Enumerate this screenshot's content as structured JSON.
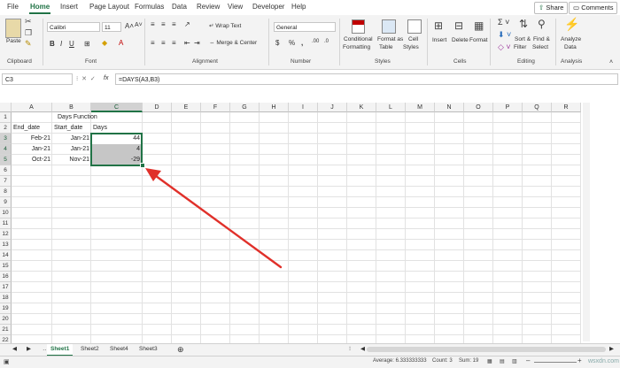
{
  "menu": {
    "items": [
      "File",
      "Home",
      "Insert",
      "Page Layout",
      "Formulas",
      "Data",
      "Review",
      "View",
      "Developer",
      "Help"
    ],
    "share_label": "Share",
    "comments_label": "Comments"
  },
  "ribbon": {
    "clipboard": {
      "paste": "Paste",
      "label": "Clipboard"
    },
    "font": {
      "name": "Calibri",
      "size": "11",
      "label": "Font"
    },
    "alignment": {
      "wrap": "Wrap Text",
      "merge": "Merge & Center",
      "label": "Alignment"
    },
    "number": {
      "format": "General",
      "label": "Number"
    },
    "styles": {
      "conditional": [
        "Conditional",
        "Formatting"
      ],
      "format_table": [
        "Format as",
        "Table"
      ],
      "cell_styles": [
        "Cell",
        "Styles"
      ],
      "label": "Styles"
    },
    "cells": {
      "insert": "Insert",
      "delete": "Delete",
      "format": "Format",
      "label": "Cells"
    },
    "editing": {
      "sort": [
        "Sort &",
        "Filter"
      ],
      "find": [
        "Find &",
        "Select"
      ],
      "label": "Editing"
    },
    "analysis": {
      "analyze": [
        "Analyze",
        "Data"
      ],
      "label": "Analysis"
    }
  },
  "formula_bar": {
    "name_box": "C3",
    "fx": "fx",
    "formula": "=DAYS(A3,B3)"
  },
  "columns": [
    "A",
    "B",
    "C",
    "D",
    "E",
    "F",
    "G",
    "H",
    "I",
    "J",
    "K",
    "L",
    "M",
    "N",
    "O",
    "P",
    "Q",
    "R"
  ],
  "rows": [
    "1",
    "2",
    "3",
    "4",
    "5",
    "6",
    "7",
    "8",
    "9",
    "10",
    "11",
    "12",
    "13",
    "14",
    "15",
    "16",
    "17",
    "18",
    "19",
    "20",
    "21",
    "22"
  ],
  "sheet": {
    "title": "Days Function",
    "headers": [
      "End_date",
      "Start_date",
      "Days"
    ],
    "data": [
      [
        "Feb-21",
        "Jan-21",
        "44"
      ],
      [
        "Jan-21",
        "Jan-21",
        "4"
      ],
      [
        "Oct-21",
        "Nov-21",
        "-29"
      ]
    ]
  },
  "tabs": [
    "Sheet1",
    "Sheet2",
    "Sheet4",
    "Sheet3"
  ],
  "status": {
    "average": "Average: 6.333333333",
    "count": "Count: 3",
    "sum": "Sum: 19",
    "watermark": "wsxdn.com"
  }
}
